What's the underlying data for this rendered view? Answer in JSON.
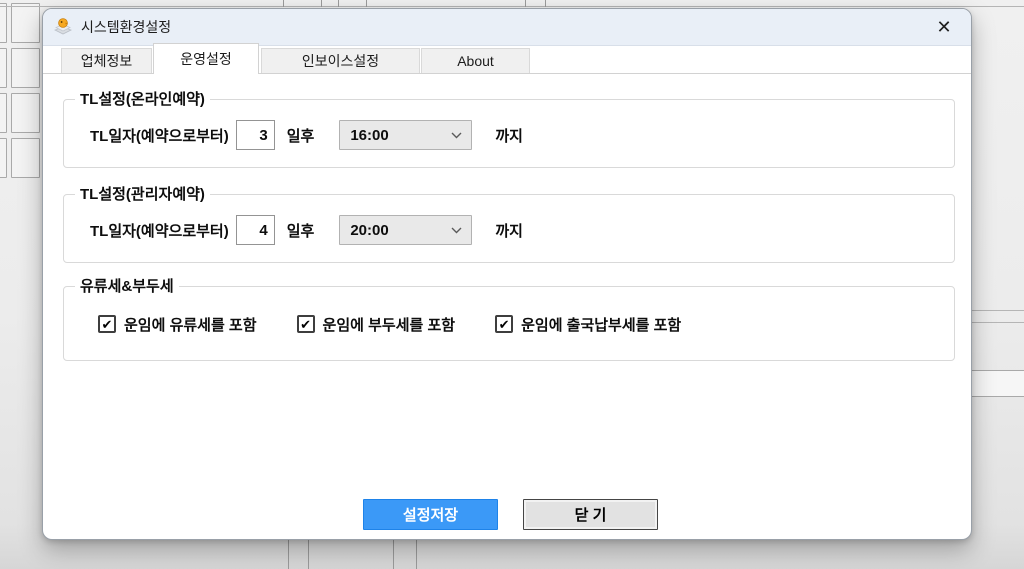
{
  "window": {
    "title": "시스템환경설정"
  },
  "icons": {
    "close": "✕",
    "check": "✔"
  },
  "tabs": [
    {
      "label": "업체정보",
      "active": false
    },
    {
      "label": "운영설정",
      "active": true
    },
    {
      "label": "인보이스설정",
      "active": false
    },
    {
      "label": "About",
      "active": false
    }
  ],
  "groups": {
    "online": {
      "title": "TL설정(온라인예약)",
      "row_label": "TL일자(예약으로부터)",
      "days_value": "3",
      "days_suffix": "일후",
      "time_value": "16:00",
      "time_suffix": "까지"
    },
    "admin": {
      "title": "TL설정(관리자예약)",
      "row_label": "TL일자(예약으로부터)",
      "days_value": "4",
      "days_suffix": "일후",
      "time_value": "20:00",
      "time_suffix": "까지"
    },
    "tax": {
      "title": "유류세&부두세",
      "checkboxes": [
        {
          "label": "운임에 유류세를 포함",
          "checked": true
        },
        {
          "label": "운임에 부두세를 포함",
          "checked": true
        },
        {
          "label": "운임에 출국납부세를 포함",
          "checked": true
        }
      ]
    }
  },
  "buttons": {
    "save": "설정저장",
    "close": "닫 기"
  },
  "colors": {
    "accent_blue": "#3b99f7",
    "titlebar_bg": "#e9eff7",
    "button_close_bg": "#e2e2e2"
  }
}
